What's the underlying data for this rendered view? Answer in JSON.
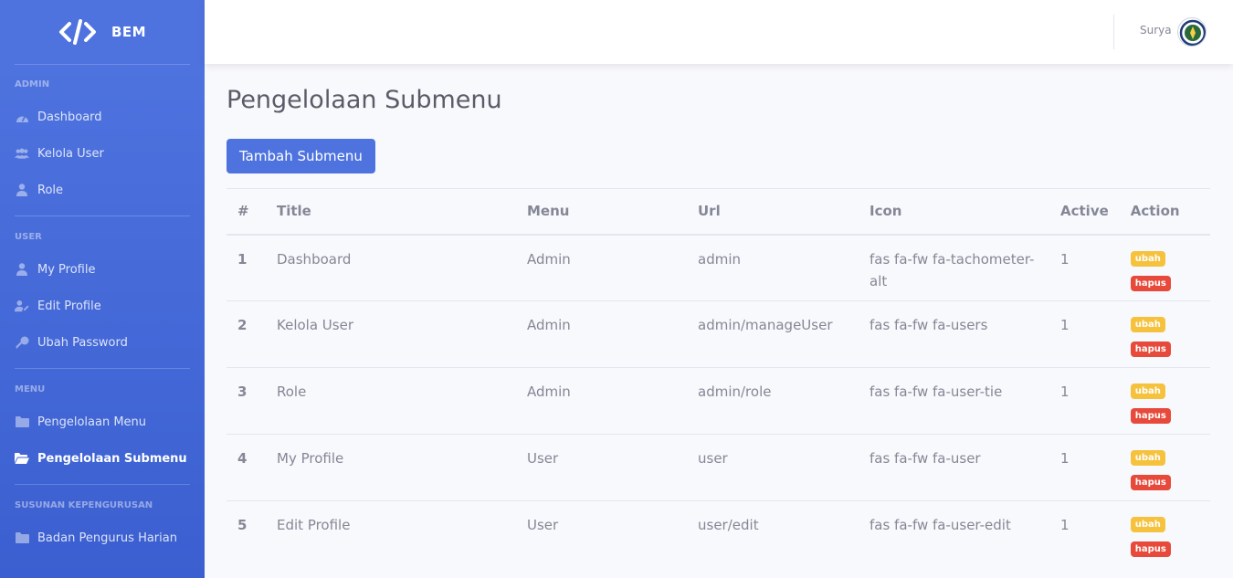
{
  "brand": {
    "name": "BEM",
    "icon": "code-icon"
  },
  "sidebar": {
    "sections": [
      {
        "heading": "ADMIN",
        "items": [
          {
            "label": "Dashboard",
            "icon": "tachometer-icon"
          },
          {
            "label": "Kelola User",
            "icon": "users-icon"
          },
          {
            "label": "Role",
            "icon": "user-tie-icon"
          }
        ]
      },
      {
        "heading": "USER",
        "items": [
          {
            "label": "My Profile",
            "icon": "user-icon"
          },
          {
            "label": "Edit Profile",
            "icon": "user-edit-icon"
          },
          {
            "label": "Ubah Password",
            "icon": "key-icon"
          }
        ]
      },
      {
        "heading": "MENU",
        "items": [
          {
            "label": "Pengelolaan Menu",
            "icon": "folder-icon"
          },
          {
            "label": "Pengelolaan Submenu",
            "icon": "folder-open-icon",
            "active": true
          }
        ]
      },
      {
        "heading": "SUSUNAN KEPENGURUSAN",
        "items": [
          {
            "label": "Badan Pengurus Harian",
            "icon": "folder-icon"
          }
        ]
      }
    ]
  },
  "topbar": {
    "user_name": "Surya"
  },
  "page": {
    "title": "Pengelolaan Submenu",
    "add_button": "Tambah Submenu"
  },
  "table": {
    "headers": [
      "#",
      "Title",
      "Menu",
      "Url",
      "Icon",
      "Active",
      "Action"
    ],
    "rows": [
      {
        "no": "1",
        "title": "Dashboard",
        "menu": "Admin",
        "url": "admin",
        "icon": "fas fa-fw fa-tachometer-alt",
        "active": "1"
      },
      {
        "no": "2",
        "title": "Kelola User",
        "menu": "Admin",
        "url": "admin/manageUser",
        "icon": "fas fa-fw fa-users",
        "active": "1"
      },
      {
        "no": "3",
        "title": "Role",
        "menu": "Admin",
        "url": "admin/role",
        "icon": "fas fa-fw fa-user-tie",
        "active": "1"
      },
      {
        "no": "4",
        "title": "My Profile",
        "menu": "User",
        "url": "user",
        "icon": "fas fa-fw fa-user",
        "active": "1"
      },
      {
        "no": "5",
        "title": "Edit Profile",
        "menu": "User",
        "url": "user/edit",
        "icon": "fas fa-fw fa-user-edit",
        "active": "1"
      }
    ],
    "edit_label": "ubah",
    "delete_label": "hapus"
  },
  "colors": {
    "primary": "#4e73df",
    "warning": "#f6c23e",
    "danger": "#e74a3b"
  }
}
